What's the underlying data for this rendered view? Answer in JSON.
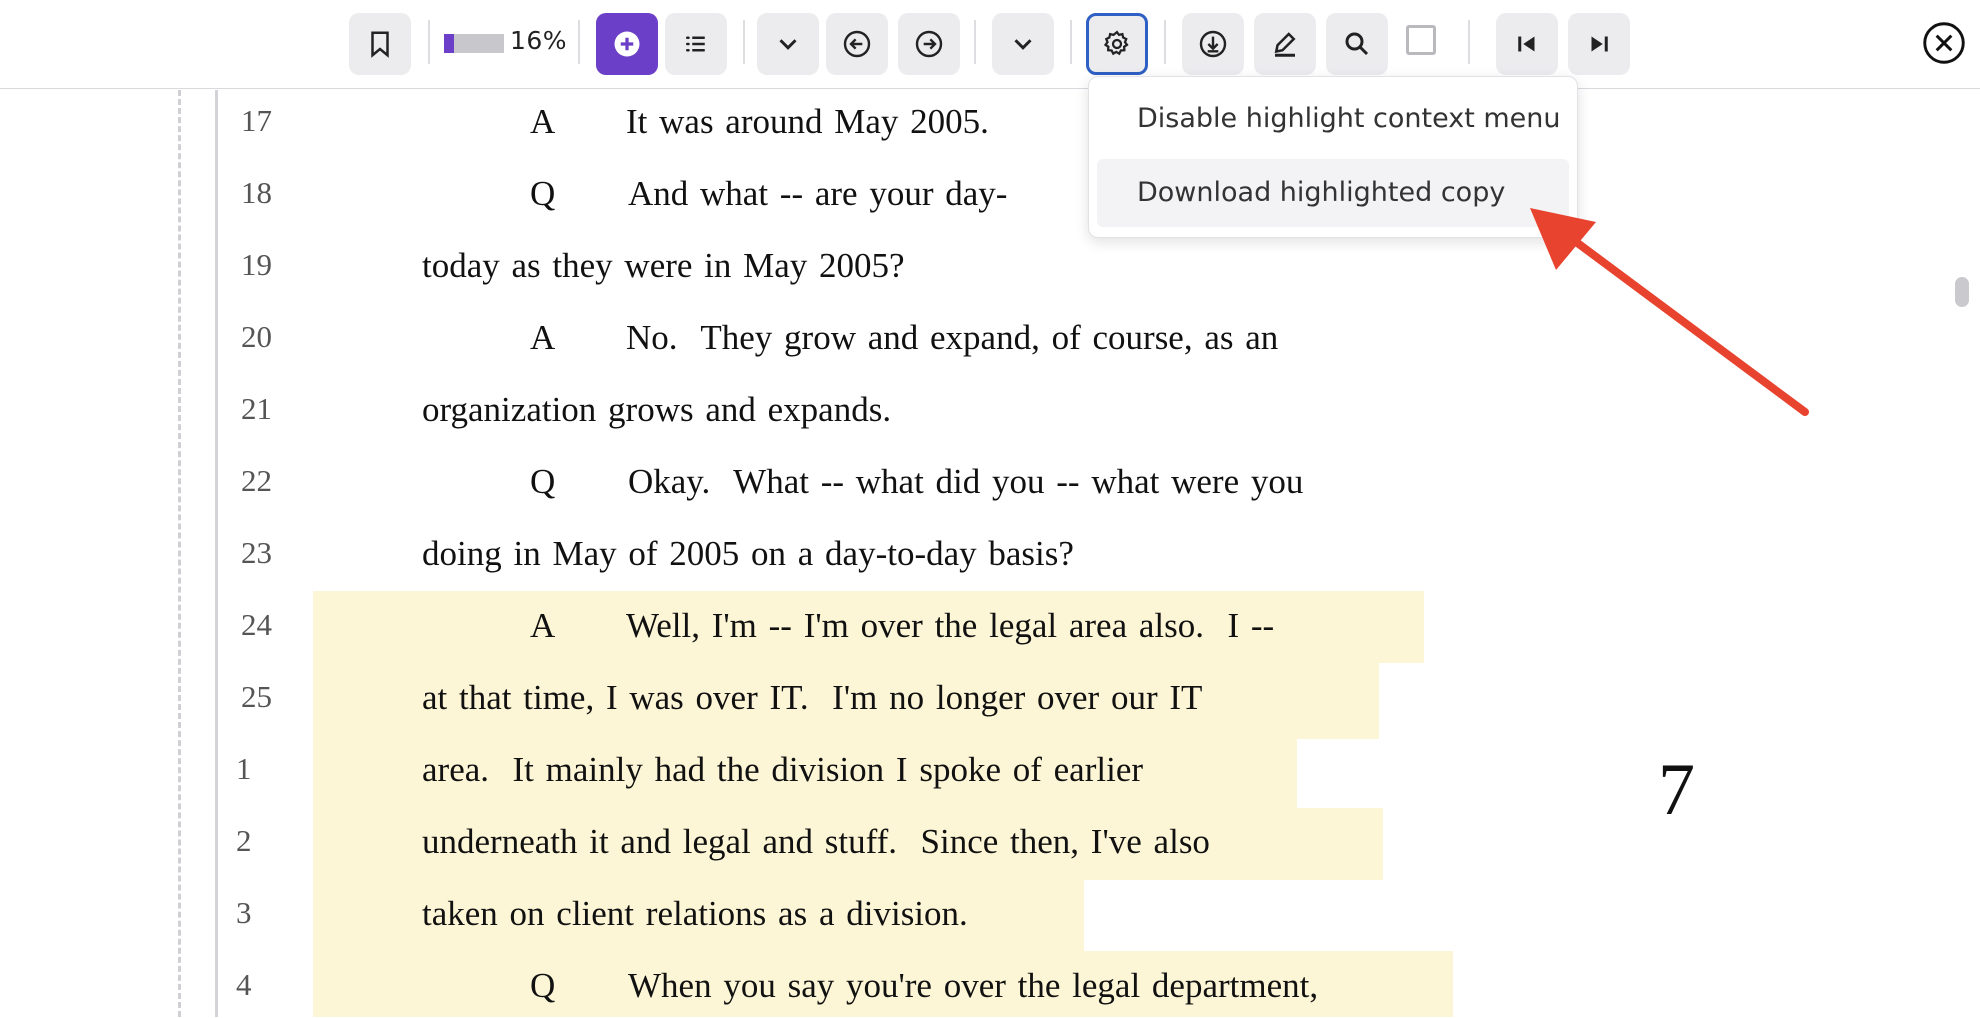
{
  "toolbar": {
    "zoom_label": "16%",
    "zoom_fraction": 0.16,
    "accent": "#6b3fc7",
    "buttons": [
      "bookmark-icon",
      "add-icon",
      "list-icon",
      "chevron-down-icon",
      "arrow-left-circle-icon",
      "arrow-right-circle-icon",
      "chevron-down-icon",
      "gear-icon",
      "download-icon",
      "pen-icon",
      "search-icon",
      "first-page-icon",
      "last-page-icon",
      "close-icon"
    ]
  },
  "menu": {
    "items": [
      {
        "label": "Disable highlight context menu"
      },
      {
        "label": "Download highlighted copy"
      }
    ]
  },
  "document": {
    "page_number": "7",
    "lines": [
      {
        "num": "17",
        "speaker": "A",
        "text": "It was around May 2005."
      },
      {
        "num": "18",
        "speaker": "Q",
        "text": "And what -- are your day-"
      },
      {
        "num": "19",
        "speaker": "",
        "text": "today as they were in May 2005?"
      },
      {
        "num": "20",
        "speaker": "A",
        "text": "No.  They grow and expand, of course, as an"
      },
      {
        "num": "21",
        "speaker": "",
        "text": "organization grows and expands."
      },
      {
        "num": "22",
        "speaker": "Q",
        "text": "Okay.  What -- what did you -- what were you"
      },
      {
        "num": "23",
        "speaker": "",
        "text": "doing in May of 2005 on a day-to-day basis?"
      },
      {
        "num": "24",
        "speaker": "A",
        "text": "Well, I'm -- I'm over the legal area also.  I --"
      },
      {
        "num": "25",
        "speaker": "",
        "text": "at that time, I was over IT.  I'm no longer over our IT"
      },
      {
        "num": "1",
        "speaker": "",
        "text": "area.  It mainly had the division I spoke of earlier"
      },
      {
        "num": "2",
        "speaker": "",
        "text": "underneath it and legal and stuff.  Since then, I've also"
      },
      {
        "num": "3",
        "speaker": "",
        "text": "taken on client relations as a division."
      },
      {
        "num": "4",
        "speaker": "Q",
        "text": "When you say you're over the legal department,"
      }
    ]
  }
}
